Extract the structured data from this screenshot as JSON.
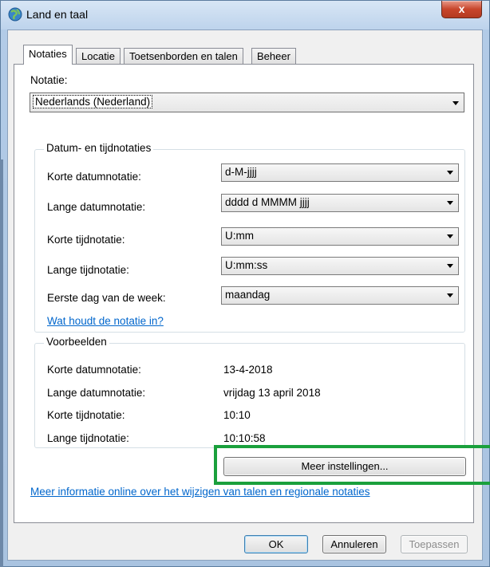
{
  "window": {
    "title": "Land en taal",
    "close_label": "x"
  },
  "tabs": [
    {
      "label": "Notaties",
      "active": true
    },
    {
      "label": "Locatie",
      "active": false
    },
    {
      "label": "Toetsenborden en talen",
      "active": false
    },
    {
      "label": "Beheer",
      "active": false
    }
  ],
  "notatie": {
    "label": "Notatie:",
    "value": "Nederlands (Nederland)"
  },
  "formats": {
    "group_title": "Datum- en tijdnotaties",
    "rows": [
      {
        "label": "Korte datumnotatie:",
        "value": "d-M-jjjj"
      },
      {
        "label": "Lange datumnotatie:",
        "value": "dddd d MMMM jjjj"
      },
      {
        "label": "Korte tijdnotatie:",
        "value": "U:mm"
      },
      {
        "label": "Lange tijdnotatie:",
        "value": "U:mm:ss"
      },
      {
        "label": "Eerste dag van de week:",
        "value": "maandag"
      }
    ],
    "help_link": "Wat houdt de notatie in?"
  },
  "examples": {
    "group_title": "Voorbeelden",
    "rows": [
      {
        "label": "Korte datumnotatie:",
        "value": "13-4-2018"
      },
      {
        "label": "Lange datumnotatie:",
        "value": "vrijdag 13 april 2018"
      },
      {
        "label": "Korte tijdnotatie:",
        "value": "10:10"
      },
      {
        "label": "Lange tijdnotatie:",
        "value": "10:10:58"
      }
    ]
  },
  "more_settings_label": "Meer instellingen...",
  "online_link": "Meer informatie online over het wijzigen van talen en regionale notaties",
  "buttons": {
    "ok": "OK",
    "cancel": "Annuleren",
    "apply": "Toepassen"
  },
  "colors": {
    "link": "#0066cc",
    "highlight": "#1aa03c"
  }
}
